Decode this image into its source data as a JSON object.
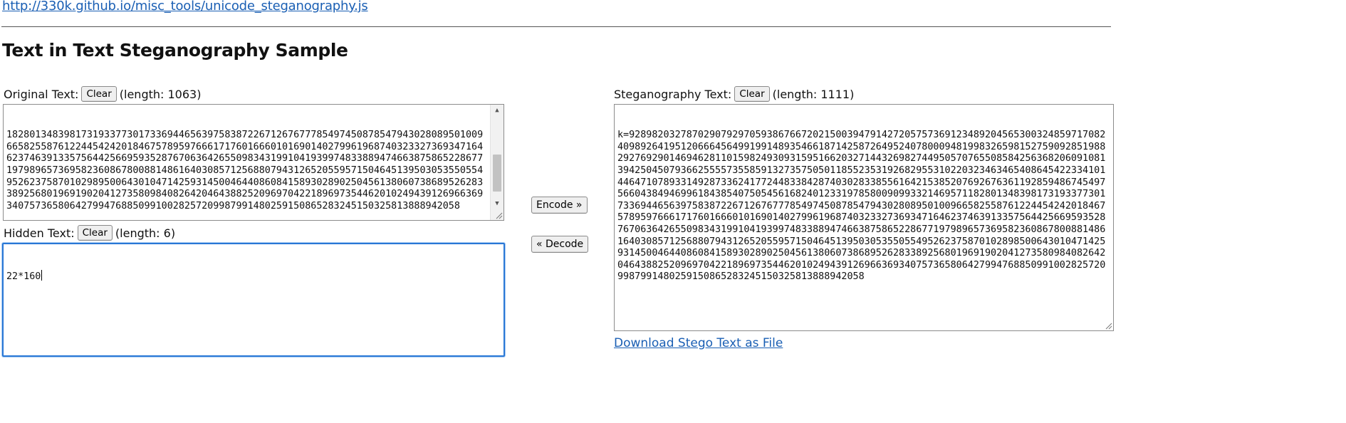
{
  "header": {
    "source_link": "http://330k.github.io/misc_tools/unicode_steganography.js",
    "title": "Text in Text Steganography Sample"
  },
  "original": {
    "label": "Original Text:",
    "clear_label": "Clear",
    "length_text": "(length: 1063)",
    "value": "182801348398173193377301733694465639758387226712676777854974508785479430280895010096658255876122445424201846757895976661717601666010169014027996196874032332736934716462374639133575644256695935287670636426550983431991041939974833889474663875865228677197989657369582360867800881486164030857125688079431265205595715046451395030535505549526237587010298950064301047142593145004644086084158930289025045613806073868952628338925680196919020412735809840826420464388252096970422189697354462010249439126966369340757365806427994768850991002825720998799148025915086528324515032581388894205​8"
  },
  "hidden": {
    "label": "Hidden Text:",
    "clear_label": "Clear",
    "length_text": "(length: 6)",
    "value": "22*160"
  },
  "actions": {
    "encode_label": "Encode »",
    "decode_label": "« Decode"
  },
  "stego": {
    "label": "Steganography Text:",
    "clear_label": "Clear",
    "length_text": "(length: 1111)",
    "value": "k=92898203278702907929705938676672021500394791427205757369123489204565300324859717082409892641951206664564991991489354661871425872649524078000948199832659815275909285198829276929014694628110159824930931595166203271443269827449505707655085842563682060910813942504507936625555735585913273575050118552353192682955310220323463465408645422334101446471078933149287336241772448338428740302833855616421538520769267636119285948674549756604384946996184385407505456168240123319785800909933214695711828013483981731933773017336944656397583872267126767778549745087854794302808950100966582558761224454242018467578959766617176016660101690140279961968740323327369347164623746391335756442566959352876706364265509834319910419399748338894746638758652286771979896573695823608678008814861640308571256880794312652055957150464513950305355055495262375870102898500643010471425931450046440860841589302890250456138060738689526283389256801969190204127358098408264204643882520969704221896973544620102494391269663693407573658064279947688509910028257209987991480259150865283245150325813888942058"
  },
  "download_link": "Download Stego Text as File"
}
